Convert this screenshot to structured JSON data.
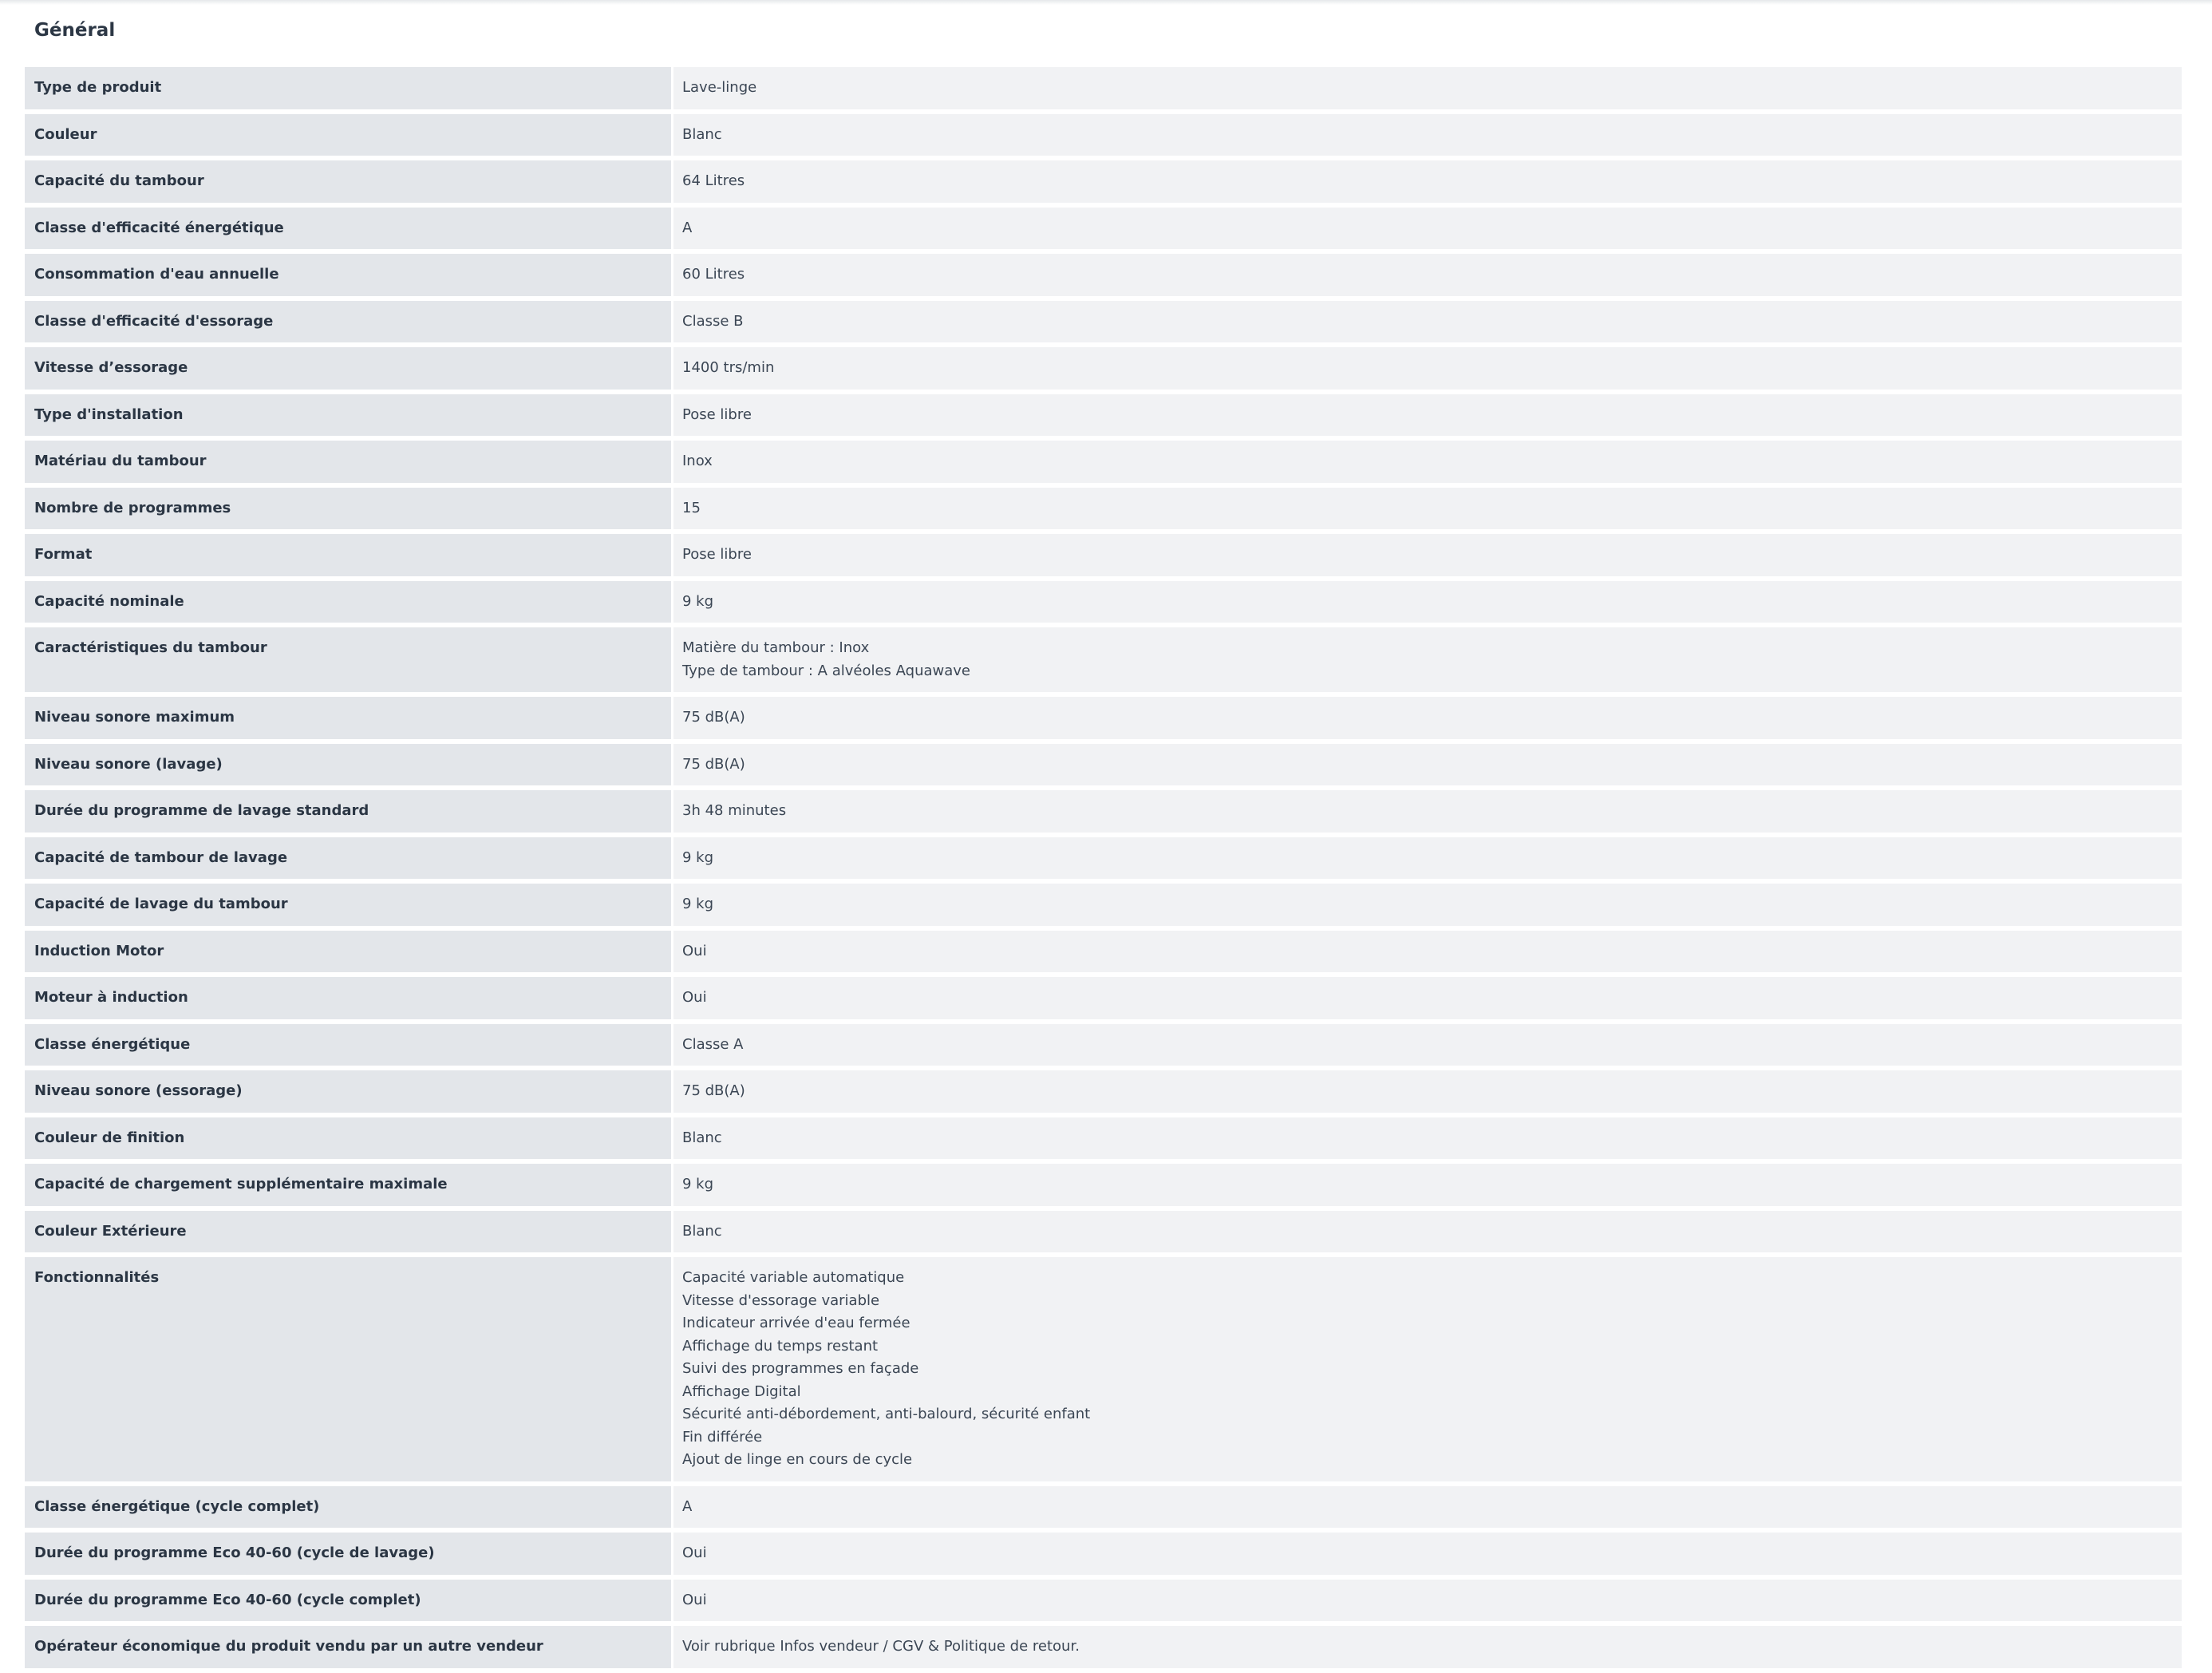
{
  "section": {
    "title": "Général"
  },
  "specs": [
    {
      "label": "Type de produit",
      "values": [
        "Lave-linge"
      ]
    },
    {
      "label": "Couleur",
      "values": [
        "Blanc"
      ]
    },
    {
      "label": "Capacité du tambour",
      "values": [
        "64 Litres"
      ]
    },
    {
      "label": "Classe d'efficacité énergétique",
      "values": [
        "A"
      ]
    },
    {
      "label": "Consommation d'eau annuelle",
      "values": [
        "60 Litres"
      ]
    },
    {
      "label": "Classe d'efficacité d'essorage",
      "values": [
        "Classe B"
      ]
    },
    {
      "label": "Vitesse d’essorage",
      "values": [
        "1400 trs/min"
      ]
    },
    {
      "label": "Type d'installation",
      "values": [
        "Pose libre"
      ]
    },
    {
      "label": "Matériau du tambour",
      "values": [
        "Inox"
      ]
    },
    {
      "label": "Nombre de programmes",
      "values": [
        "15"
      ]
    },
    {
      "label": "Format",
      "values": [
        "Pose libre"
      ]
    },
    {
      "label": "Capacité nominale",
      "values": [
        "9 kg"
      ]
    },
    {
      "label": "Caractéristiques du tambour",
      "values": [
        "Matière du tambour : Inox",
        "Type de tambour : A alvéoles Aquawave"
      ]
    },
    {
      "label": "Niveau sonore maximum",
      "values": [
        "75 dB(A)"
      ]
    },
    {
      "label": "Niveau sonore (lavage)",
      "values": [
        "75 dB(A)"
      ]
    },
    {
      "label": "Durée du programme de lavage standard",
      "values": [
        "3h 48 minutes"
      ]
    },
    {
      "label": "Capacité de tambour de lavage",
      "values": [
        "9 kg"
      ]
    },
    {
      "label": "Capacité de lavage du tambour",
      "values": [
        "9 kg"
      ]
    },
    {
      "label": "Induction Motor",
      "values": [
        "Oui"
      ]
    },
    {
      "label": "Moteur à induction",
      "values": [
        "Oui"
      ]
    },
    {
      "label": "Classe énergétique",
      "values": [
        "Classe A"
      ]
    },
    {
      "label": "Niveau sonore (essorage)",
      "values": [
        "75 dB(A)"
      ]
    },
    {
      "label": "Couleur de finition",
      "values": [
        "Blanc"
      ]
    },
    {
      "label": "Capacité de chargement supplémentaire maximale",
      "values": [
        "9 kg"
      ]
    },
    {
      "label": "Couleur Extérieure",
      "values": [
        "Blanc"
      ]
    },
    {
      "label": "Fonctionnalités",
      "values": [
        "Capacité variable automatique",
        "Vitesse d'essorage variable",
        "Indicateur arrivée d'eau fermée",
        "Affichage du temps restant",
        "Suivi des programmes en façade",
        "Affichage Digital",
        "Sécurité anti-débordement, anti-balourd, sécurité enfant",
        "Fin différée",
        "Ajout de linge en cours de cycle"
      ]
    },
    {
      "label": "Classe énergétique (cycle complet)",
      "values": [
        "A"
      ]
    },
    {
      "label": "Durée du programme Eco 40-60 (cycle de lavage)",
      "values": [
        "Oui"
      ]
    },
    {
      "label": "Durée du programme Eco 40-60 (cycle complet)",
      "values": [
        "Oui"
      ]
    },
    {
      "label": "Opérateur économique du produit vendu par un autre vendeur",
      "values": [
        "Voir rubrique Infos vendeur / CGV & Politique de retour."
      ]
    }
  ]
}
